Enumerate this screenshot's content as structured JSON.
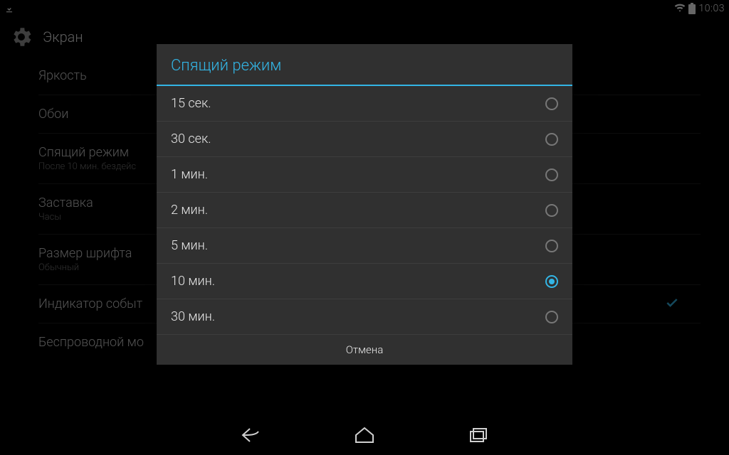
{
  "status": {
    "time": "10:03"
  },
  "header": {
    "title": "Экран"
  },
  "settings": [
    {
      "title": "Яркость",
      "sub": ""
    },
    {
      "title": "Обои",
      "sub": ""
    },
    {
      "title": "Спящий режим",
      "sub": "После 10 мин. бездейс"
    },
    {
      "title": "Заставка",
      "sub": "Часы"
    },
    {
      "title": "Размер шрифта",
      "sub": "Обычный"
    },
    {
      "title": "Индикатор событ",
      "sub": "",
      "checked": true
    },
    {
      "title": "Беспроводной мо",
      "sub": ""
    }
  ],
  "dialog": {
    "title": "Спящий режим",
    "options": [
      {
        "label": "15 сек.",
        "selected": false
      },
      {
        "label": "30 сек.",
        "selected": false
      },
      {
        "label": "1 мин.",
        "selected": false
      },
      {
        "label": "2 мин.",
        "selected": false
      },
      {
        "label": "5 мин.",
        "selected": false
      },
      {
        "label": "10 мин.",
        "selected": true
      },
      {
        "label": "30 мин.",
        "selected": false
      }
    ],
    "cancel": "Отмена"
  }
}
